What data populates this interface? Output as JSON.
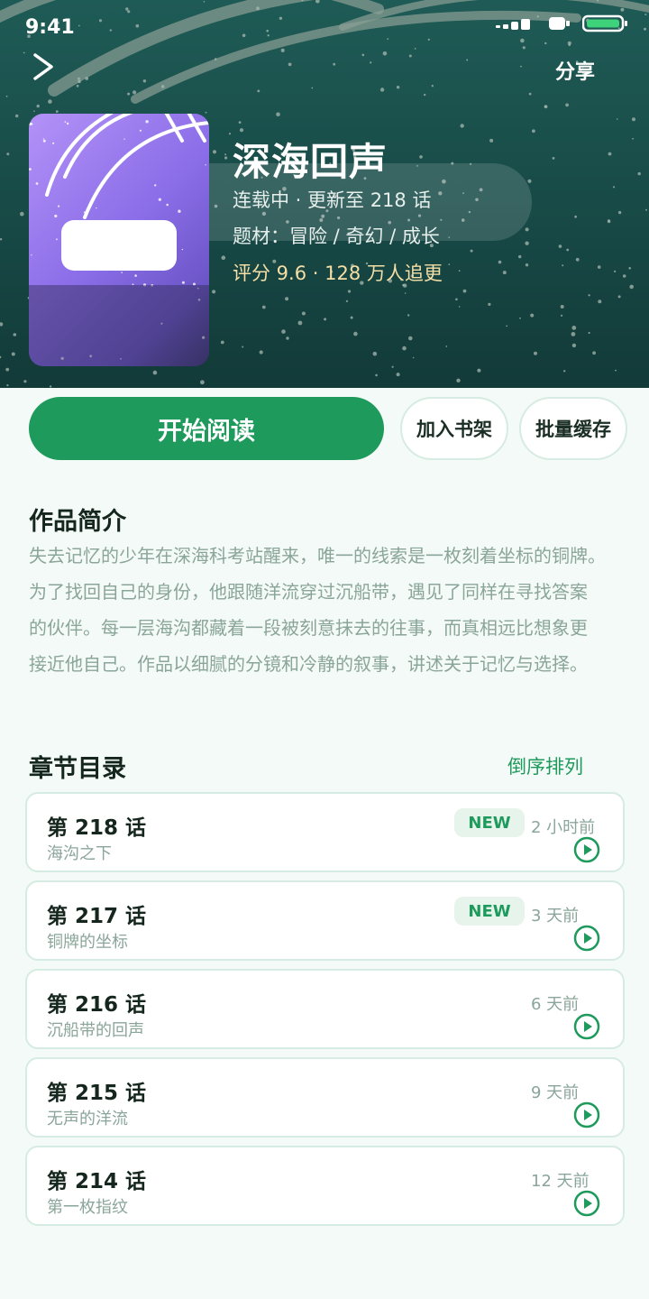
{
  "status": {
    "time": "9:41"
  },
  "nav": {
    "share_label": "分享"
  },
  "book": {
    "title": "深海回声",
    "status_line": "连载中 · 更新至 218 话",
    "genre_line": "题材：冒险 / 奇幻 / 成长",
    "rating_line": "评分 9.6 · 128 万人追更"
  },
  "actions": {
    "read_label": "开始阅读",
    "shelf_label": "加入书架",
    "cache_label": "批量缓存"
  },
  "intro": {
    "heading": "作品简介",
    "text": "失去记忆的少年在深海科考站醒来，唯一的线索是一枚刻着坐标的铜牌。\n为了找回自己的身份，他跟随洋流穿过沉船带，遇见了同样在寻找答案\n的伙伴。每一层海沟都藏着一段被刻意抹去的往事，而真相远比想象更\n接近他自己。作品以细腻的分镜和冷静的叙事，讲述关于记忆与选择。"
  },
  "chapters": {
    "heading": "章节目录",
    "sort_label": "倒序排列",
    "items": [
      {
        "number": "第 218 话",
        "name": "海沟之下",
        "badge": "NEW",
        "time": "2 小时前"
      },
      {
        "number": "第 217 话",
        "name": "铜牌的坐标",
        "badge": "NEW",
        "time": "3 天前"
      },
      {
        "number": "第 216 话",
        "name": "沉船带的回声",
        "badge": "",
        "time": "6 天前"
      },
      {
        "number": "第 215 话",
        "name": "无声的洋流",
        "badge": "",
        "time": "9 天前"
      },
      {
        "number": "第 214 话",
        "name": "第一枚指纹",
        "badge": "",
        "time": "12 天前"
      }
    ]
  },
  "colors": {
    "accent": "#1e9a5c",
    "hero_bg": "#1f5b56",
    "cover": "#8a6de8",
    "rating": "#f5dfa6"
  },
  "icons": {
    "back": "chevron-right-icon",
    "signal": "signal-icon",
    "wifi": "wifi-icon",
    "battery": "battery-icon",
    "play": "play-circle-icon"
  }
}
